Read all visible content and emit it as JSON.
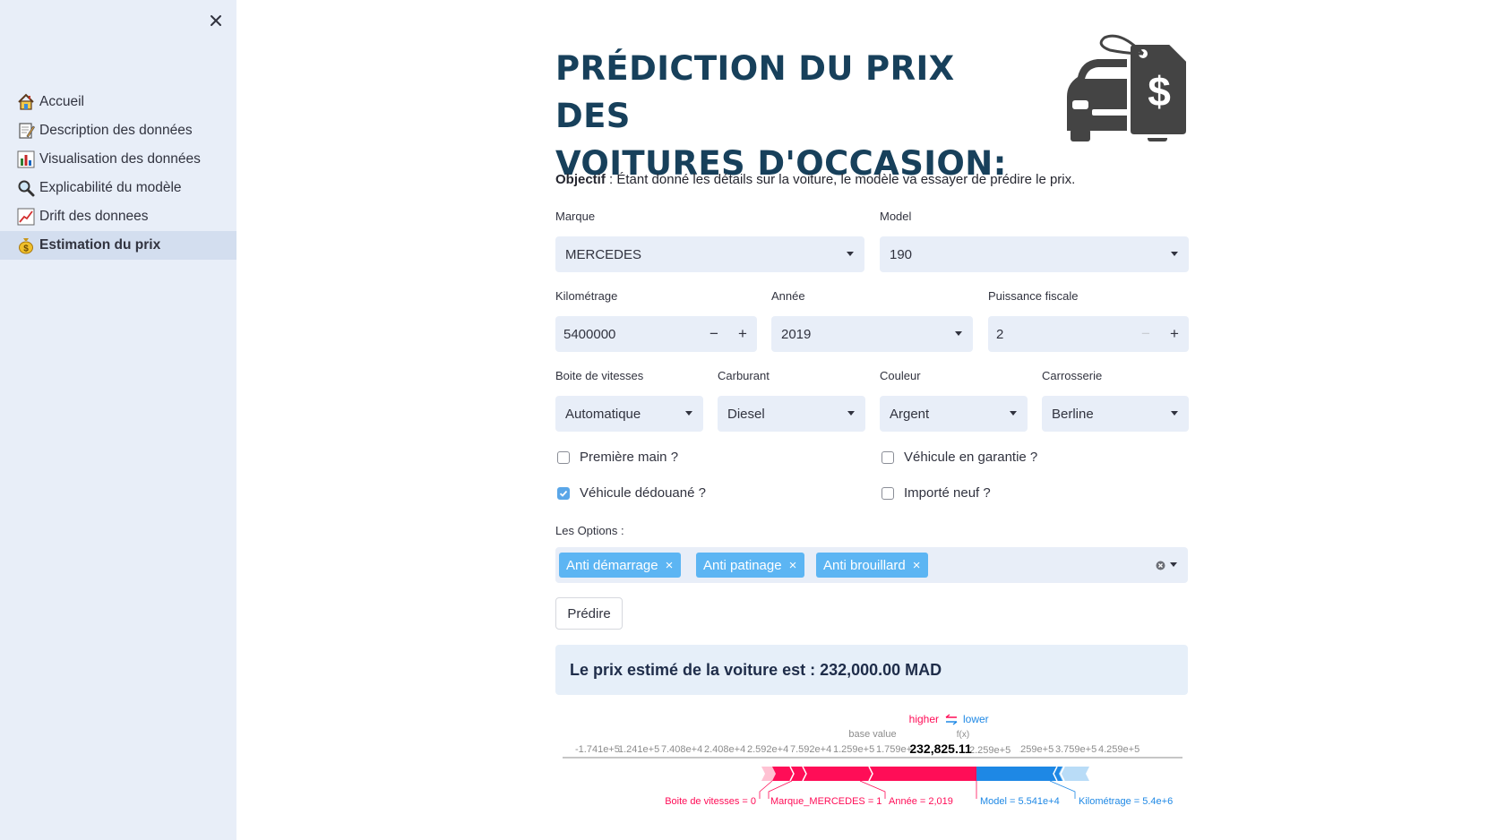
{
  "sidebar": {
    "close_icon": "close-icon",
    "items": [
      {
        "label": "Accueil",
        "icon": "house-icon"
      },
      {
        "label": "Description des données",
        "icon": "memo-icon"
      },
      {
        "label": "Visualisation des données",
        "icon": "bar-chart-icon"
      },
      {
        "label": "Explicabilité du modèle",
        "icon": "magnifier-icon"
      },
      {
        "label": "Drift des donnees",
        "icon": "trend-chart-icon"
      },
      {
        "label": "Estimation du prix",
        "icon": "money-bag-icon",
        "active": true
      }
    ]
  },
  "main": {
    "title_line1": "PRÉDICTION DU PRIX DES",
    "title_line2": "VOITURES D'OCCASION:",
    "hero_icon": "car-price-tag-icon",
    "objectif_label": "Objectif",
    "objectif_text": " : Étant donné les détails sur la voiture, le modèle va essayer de prédire le prix.",
    "fields": {
      "marque": {
        "label": "Marque",
        "value": "MERCEDES"
      },
      "model": {
        "label": "Model",
        "value": "190"
      },
      "kilometrage": {
        "label": "Kilométrage",
        "value": "5400000",
        "minus": "−",
        "plus": "+"
      },
      "annee": {
        "label": "Année",
        "value": "2019"
      },
      "puissance": {
        "label": "Puissance fiscale",
        "value": "2",
        "minus": "−",
        "plus": "+"
      },
      "boite": {
        "label": "Boite de vitesses",
        "value": "Automatique"
      },
      "carburant": {
        "label": "Carburant",
        "value": "Diesel"
      },
      "couleur": {
        "label": "Couleur",
        "value": "Argent"
      },
      "carrosserie": {
        "label": "Carrosserie",
        "value": "Berline"
      }
    },
    "checkboxes": {
      "premiere_main": {
        "label": "Première main ?",
        "checked": false
      },
      "garantie": {
        "label": "Véhicule en garantie ?",
        "checked": false
      },
      "dedouane": {
        "label": "Véhicule dédouané ?",
        "checked": true
      },
      "importe": {
        "label": "Importé neuf ?",
        "checked": false
      }
    },
    "options": {
      "label": "Les Options :",
      "selected": [
        "Anti démarrage",
        "Anti patinage",
        "Anti brouillard"
      ],
      "remove_glyph": "×"
    },
    "predict_button": "Prédire",
    "result_text": "Le prix estimé de la voiture est : 232,000.00 MAD"
  },
  "shap_plot": {
    "higher_label": "higher",
    "lower_label": "lower",
    "base_value_label": "base value",
    "fx_label": "f(x)",
    "fx_value": "232,825.11",
    "ticks_left": [
      "-1.741e+5",
      "1.241e+5",
      "7.408e+4",
      "2.408e+4",
      "2.592e+4",
      "7.592e+4",
      "1.259e+5",
      "1.759e+5"
    ],
    "ticks_right": [
      "2.259e+5",
      "3.259e+5",
      "3.759e+5",
      "4.259e+5"
    ],
    "positive_features": [
      "Boite de vitesses = 0",
      "Marque_MERCEDES = 1",
      "Année = 2,019"
    ],
    "negative_features": [
      "Model = 5.541e+4",
      "Kilométrage = 5.4e+6"
    ],
    "colors": {
      "positive": "#ff0d57",
      "negative": "#1e88e5",
      "axis": "#8c8c8c"
    }
  }
}
